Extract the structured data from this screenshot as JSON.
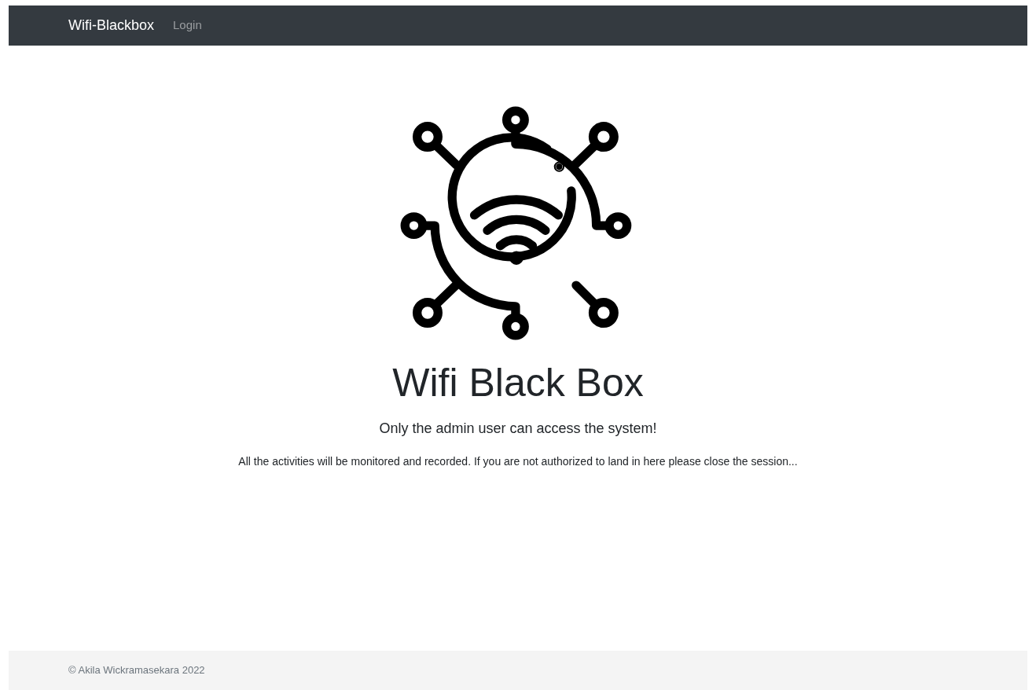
{
  "navbar": {
    "brand": "Wifi-Blackbox",
    "links": [
      {
        "label": "Login",
        "selected": false
      }
    ]
  },
  "hero": {
    "title": "Wifi Black Box",
    "subtitle": "Only the admin user can access the system!",
    "notice": "All the activities will be monitored and recorded. If you are not authorized to land in here please close the session..."
  },
  "footer": {
    "text": "© Akila Wickramasekara 2022"
  }
}
